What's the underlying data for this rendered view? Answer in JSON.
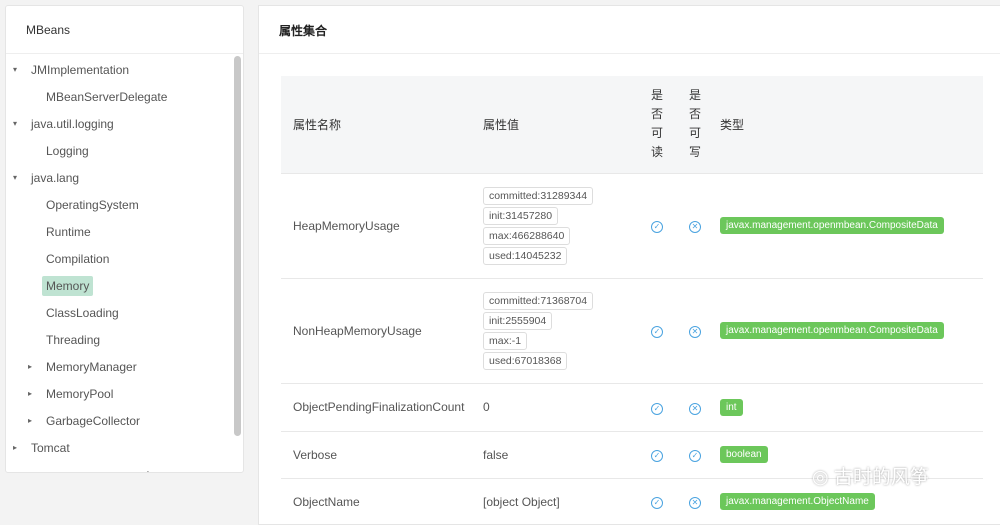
{
  "sidebar": {
    "title": "MBeans",
    "items": [
      {
        "label": "JMImplementation",
        "level": 0,
        "caret": "▾"
      },
      {
        "label": "MBeanServerDelegate",
        "level": 1,
        "caret": ""
      },
      {
        "label": "java.util.logging",
        "level": 0,
        "caret": "▾"
      },
      {
        "label": "Logging",
        "level": 1,
        "caret": ""
      },
      {
        "label": "java.lang",
        "level": 0,
        "caret": "▾"
      },
      {
        "label": "OperatingSystem",
        "level": 1,
        "caret": ""
      },
      {
        "label": "Runtime",
        "level": 1,
        "caret": ""
      },
      {
        "label": "Compilation",
        "level": 1,
        "caret": ""
      },
      {
        "label": "Memory",
        "level": 1,
        "caret": "",
        "selected": true
      },
      {
        "label": "ClassLoading",
        "level": 1,
        "caret": ""
      },
      {
        "label": "Threading",
        "level": 1,
        "caret": ""
      },
      {
        "label": "MemoryManager",
        "level": 1,
        "caret": "▸"
      },
      {
        "label": "MemoryPool",
        "level": 1,
        "caret": "▸"
      },
      {
        "label": "GarbageCollector",
        "level": 1,
        "caret": "▸"
      },
      {
        "label": "Tomcat",
        "level": 0,
        "caret": "▸"
      },
      {
        "label": "com.sun.management",
        "level": 0,
        "caret": "▸"
      }
    ]
  },
  "main": {
    "title": "属性集合",
    "headers": {
      "name": "属性名称",
      "value": "属性值",
      "readable": "是否可读",
      "writable": "是否可写",
      "type": "类型"
    },
    "rows": [
      {
        "name": "HeapMemoryUsage",
        "value": [
          "committed:31289344",
          "init:31457280",
          "max:466288640",
          "used:14045232"
        ],
        "readable": true,
        "writable": false,
        "type": "javax.management.openmbean.CompositeData"
      },
      {
        "name": "NonHeapMemoryUsage",
        "value": [
          "committed:71368704",
          "init:2555904",
          "max:-1",
          "used:67018368"
        ],
        "readable": true,
        "writable": false,
        "type": "javax.management.openmbean.CompositeData"
      },
      {
        "name": "ObjectPendingFinalizationCount",
        "value": "0",
        "readable": true,
        "writable": false,
        "type": "int"
      },
      {
        "name": "Verbose",
        "value": "false",
        "readable": true,
        "writable": true,
        "type": "boolean"
      },
      {
        "name": "ObjectName",
        "value": "[object Object]",
        "readable": true,
        "writable": false,
        "type": "javax.management.ObjectName"
      }
    ]
  },
  "watermark": "古时的风筝"
}
